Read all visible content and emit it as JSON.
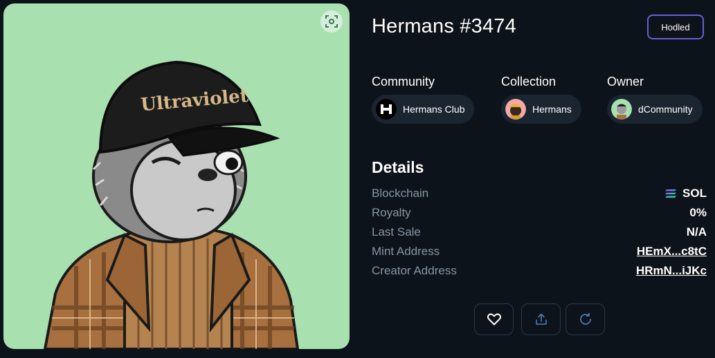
{
  "nft": {
    "title": "Hermans #3474",
    "hat_text": "Ultraviolet"
  },
  "status_button": {
    "label": "Hodled"
  },
  "meta": {
    "community": {
      "label": "Community",
      "value": "Hermans Club",
      "icon": "hermans-club-logo"
    },
    "collection": {
      "label": "Collection",
      "value": "Hermans",
      "icon": "hermans-avatar"
    },
    "owner": {
      "label": "Owner",
      "value": "dCommunity",
      "icon": "dcommunity-avatar"
    }
  },
  "details": {
    "title": "Details",
    "rows": [
      {
        "key": "Blockchain",
        "value": "SOL",
        "icon": "solana-icon"
      },
      {
        "key": "Royalty",
        "value": "0%"
      },
      {
        "key": "Last Sale",
        "value": "N/A"
      },
      {
        "key": "Mint Address",
        "value": "HEmX...c8tC",
        "link": true
      },
      {
        "key": "Creator Address",
        "value": "HRmN...iJKc",
        "link": true
      }
    ]
  },
  "actions": [
    "heart-icon",
    "share-icon",
    "refresh-icon"
  ],
  "colors": {
    "background": "#0d131a",
    "art_background": "#a9e0b0",
    "hodled_border": "#6a5fd6",
    "chip_background": "#1b2530",
    "muted_text": "#8795a3"
  }
}
